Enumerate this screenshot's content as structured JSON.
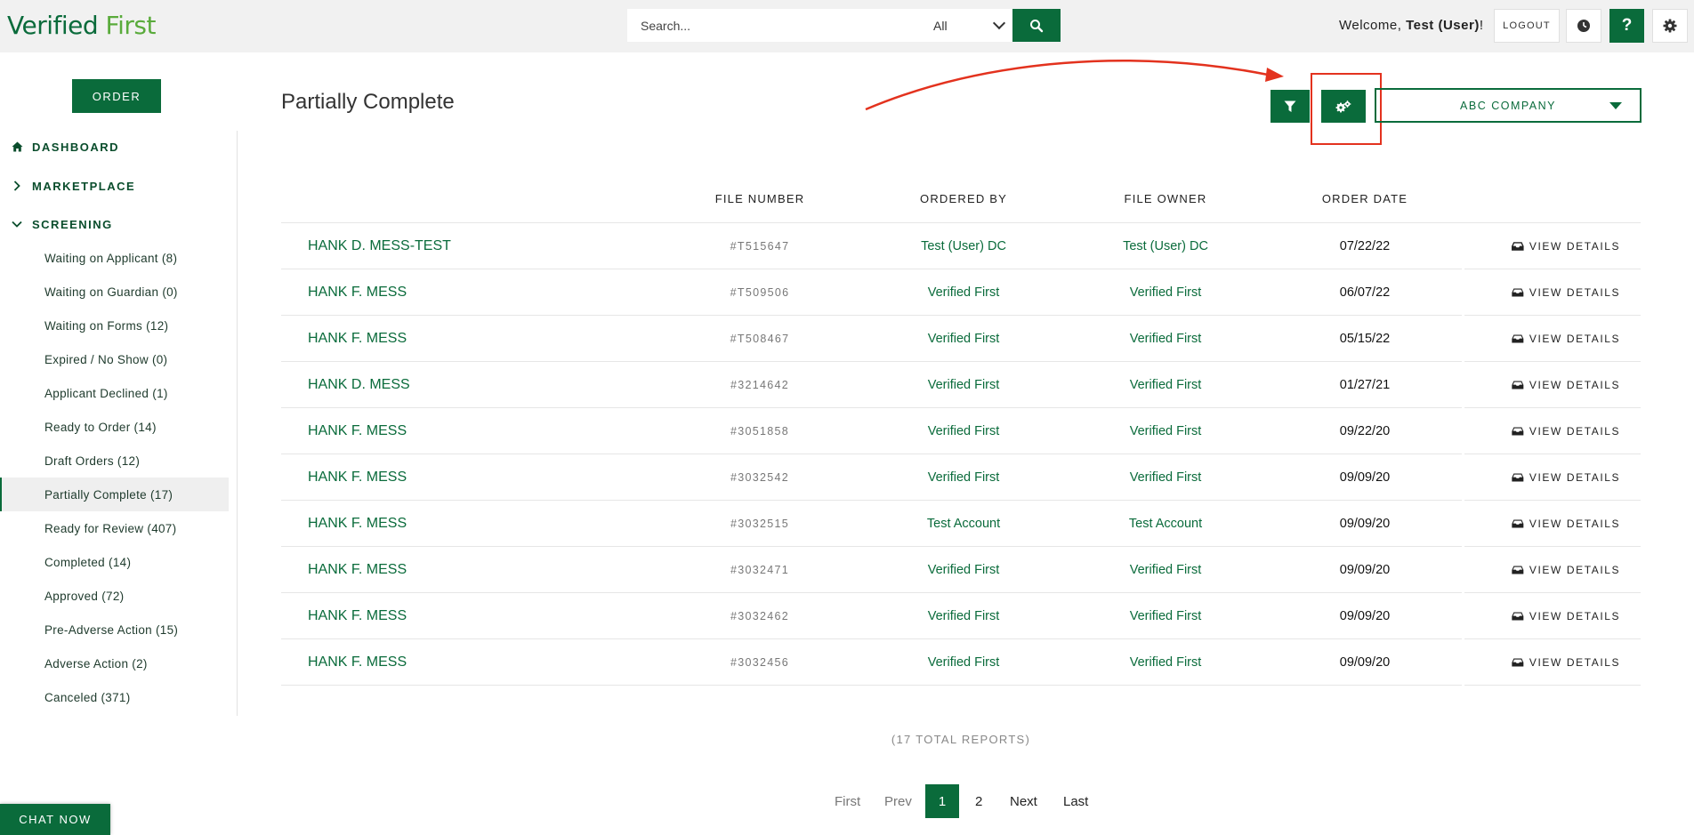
{
  "header": {
    "logo_part1": "Verified",
    "logo_part2": "First",
    "search_placeholder": "Search...",
    "search_scope": "All",
    "welcome_prefix": "Welcome, ",
    "welcome_user": "Test (User)",
    "welcome_suffix": "!",
    "logout_label": "LOGOUT",
    "help_label": "?"
  },
  "sidebar": {
    "order_label": "ORDER",
    "top_items": [
      {
        "label": "DASHBOARD",
        "icon": "home-icon"
      },
      {
        "label": "MARKETPLACE",
        "icon": "chevron-right-icon"
      },
      {
        "label": "SCREENING",
        "icon": "chevron-down-icon"
      }
    ],
    "screening_items": [
      {
        "label": "Waiting on Applicant (8)"
      },
      {
        "label": "Waiting on Guardian (0)"
      },
      {
        "label": "Waiting on Forms (12)"
      },
      {
        "label": "Expired / No Show (0)"
      },
      {
        "label": "Applicant Declined (1)"
      },
      {
        "label": "Ready to Order (14)"
      },
      {
        "label": "Draft Orders (12)"
      },
      {
        "label": "Partially Complete (17)",
        "active": true
      },
      {
        "label": "Ready for Review (407)"
      },
      {
        "label": "Completed (14)"
      },
      {
        "label": "Approved (72)"
      },
      {
        "label": "Pre-Adverse Action (15)"
      },
      {
        "label": "Adverse Action (2)"
      },
      {
        "label": "Canceled (371)"
      }
    ],
    "chat_label": "CHAT NOW"
  },
  "main": {
    "title": "Partially Complete",
    "company_label": "ABC COMPANY",
    "columns": [
      "FILE NUMBER",
      "ORDERED BY",
      "FILE OWNER",
      "ORDER DATE"
    ],
    "view_label": "VIEW DETAILS",
    "rows": [
      {
        "name": "HANK D. MESS-TEST",
        "file": "#T515647",
        "ordered_by": "Test (User) DC",
        "owner": "Test (User) DC",
        "date": "07/22/22"
      },
      {
        "name": "HANK F. MESS",
        "file": "#T509506",
        "ordered_by": "Verified First",
        "owner": "Verified First",
        "date": "06/07/22"
      },
      {
        "name": "HANK F. MESS",
        "file": "#T508467",
        "ordered_by": "Verified First",
        "owner": "Verified First",
        "date": "05/15/22"
      },
      {
        "name": "HANK D. MESS",
        "file": "#3214642",
        "ordered_by": "Verified First",
        "owner": "Verified First",
        "date": "01/27/21"
      },
      {
        "name": "HANK F. MESS",
        "file": "#3051858",
        "ordered_by": "Verified First",
        "owner": "Verified First",
        "date": "09/22/20"
      },
      {
        "name": "HANK F. MESS",
        "file": "#3032542",
        "ordered_by": "Verified First",
        "owner": "Verified First",
        "date": "09/09/20"
      },
      {
        "name": "HANK F. MESS",
        "file": "#3032515",
        "ordered_by": "Test Account",
        "owner": "Test Account",
        "date": "09/09/20"
      },
      {
        "name": "HANK F. MESS",
        "file": "#3032471",
        "ordered_by": "Verified First",
        "owner": "Verified First",
        "date": "09/09/20"
      },
      {
        "name": "HANK F. MESS",
        "file": "#3032462",
        "ordered_by": "Verified First",
        "owner": "Verified First",
        "date": "09/09/20"
      },
      {
        "name": "HANK F. MESS",
        "file": "#3032456",
        "ordered_by": "Verified First",
        "owner": "Verified First",
        "date": "09/09/20"
      }
    ],
    "total_text": "(17 TOTAL REPORTS)",
    "pagination": {
      "first": "First",
      "prev": "Prev",
      "pages": [
        "1",
        "2"
      ],
      "current": "1",
      "next": "Next",
      "last": "Last"
    }
  },
  "colors": {
    "brand_green": "#0a6b3b",
    "logo_light_green": "#5aab3c",
    "annotation_red": "#e3321e"
  }
}
